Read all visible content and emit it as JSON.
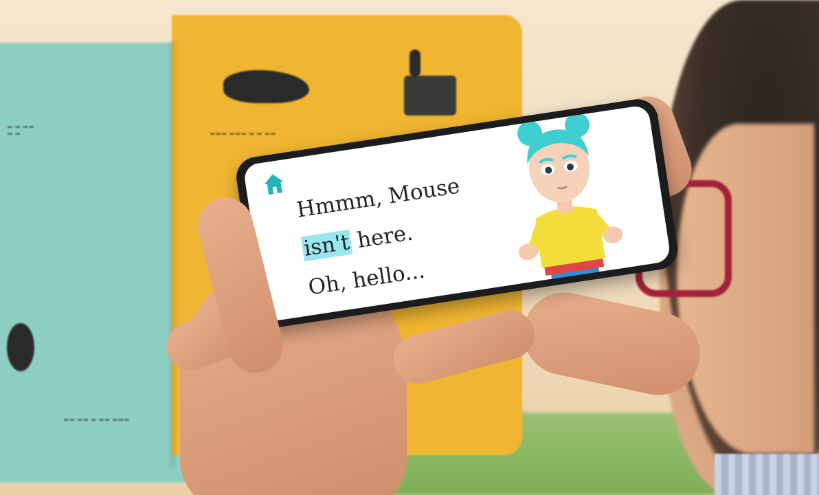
{
  "app": {
    "home_icon": "home-icon",
    "accent_color": "#21b3b5",
    "highlight_color": "#98e6f0"
  },
  "story": {
    "line1": "Hmmm, Mouse",
    "line2_highlight": "isn't",
    "line2_rest": " here.",
    "line3": "Oh, hello..."
  },
  "avatar": {
    "hair_color": "#3fcfd0",
    "top_color": "#f2dd3b",
    "trousers_color": "#2e8fd8"
  }
}
